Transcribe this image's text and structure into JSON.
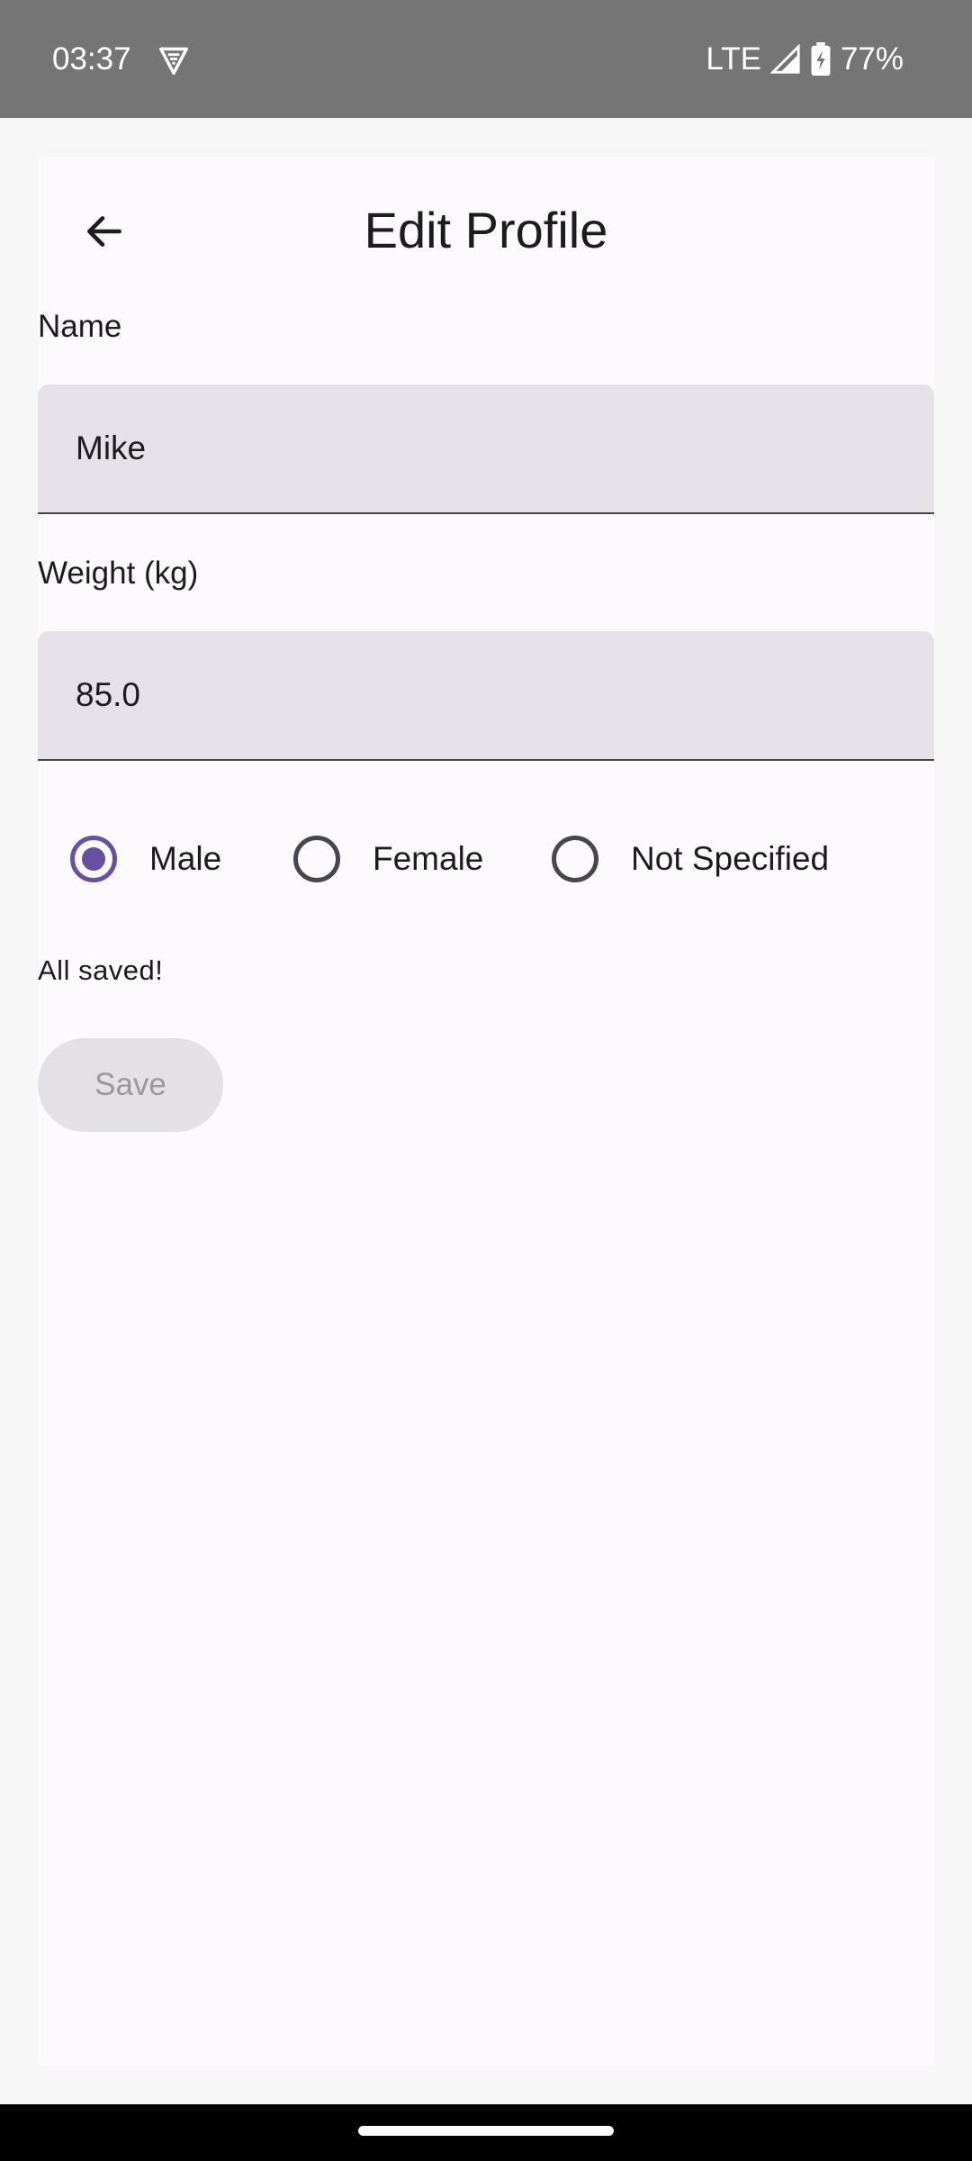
{
  "status_bar": {
    "time": "03:37",
    "network": "LTE",
    "battery": "77%",
    "icons": [
      "vpn-shield-icon",
      "signal-icon",
      "battery-charging-icon"
    ]
  },
  "header": {
    "title": "Edit Profile",
    "back_icon": "arrow-left-icon"
  },
  "form": {
    "name": {
      "label": "Name",
      "value": "Mike"
    },
    "weight": {
      "label": "Weight (kg)",
      "value": "85.0"
    },
    "gender": {
      "options": [
        "Male",
        "Female",
        "Not Specified"
      ],
      "selected": "Male"
    },
    "status_message": "All saved!",
    "save_label": "Save"
  },
  "colors": {
    "accent": "#6750a4",
    "field_background": "#e6e0e9",
    "status_bar": "#757575",
    "disabled_button": "#e3e1e5"
  }
}
